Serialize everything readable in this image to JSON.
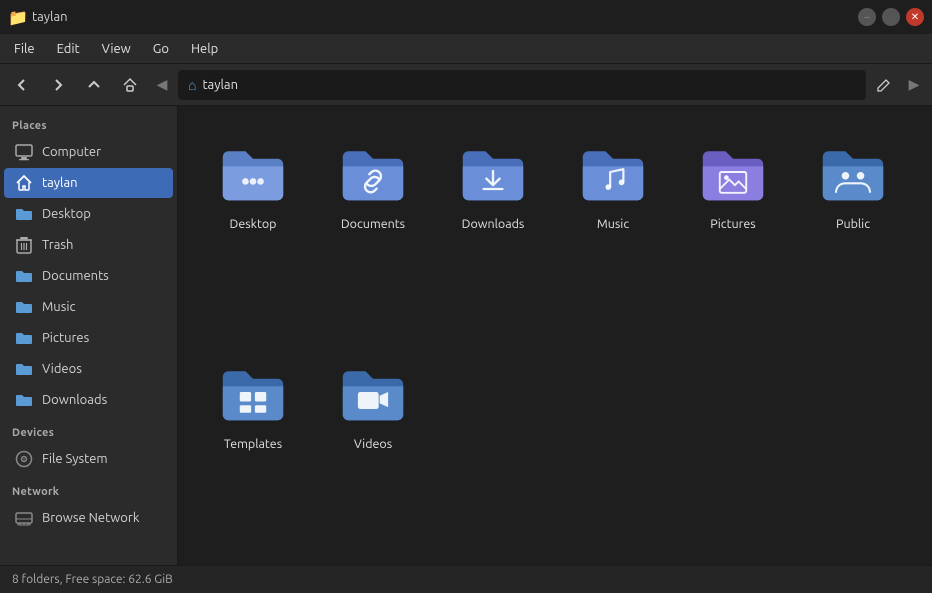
{
  "titlebar": {
    "title": "taylan",
    "icon": "📁"
  },
  "menubar": {
    "items": [
      "File",
      "Edit",
      "View",
      "Go",
      "Help"
    ]
  },
  "toolbar": {
    "back_label": "◀",
    "forward_label": "▶",
    "up_label": "▲",
    "home_label": "⌂",
    "breadcrumb_icon": "⌂",
    "breadcrumb_text": "taylan",
    "edit_label": "✏",
    "nav_left_label": "◀",
    "nav_right_label": "▶"
  },
  "sidebar": {
    "places_label": "Places",
    "devices_label": "Devices",
    "network_label": "Network",
    "items_places": [
      {
        "id": "computer",
        "label": "Computer",
        "icon": "computer"
      },
      {
        "id": "taylan",
        "label": "taylan",
        "icon": "home",
        "active": true
      },
      {
        "id": "desktop",
        "label": "Desktop",
        "icon": "folder"
      },
      {
        "id": "trash",
        "label": "Trash",
        "icon": "trash"
      },
      {
        "id": "documents",
        "label": "Documents",
        "icon": "folder"
      },
      {
        "id": "music",
        "label": "Music",
        "icon": "folder"
      },
      {
        "id": "pictures",
        "label": "Pictures",
        "icon": "folder"
      },
      {
        "id": "videos",
        "label": "Videos",
        "icon": "folder"
      },
      {
        "id": "downloads",
        "label": "Downloads",
        "icon": "folder"
      }
    ],
    "items_devices": [
      {
        "id": "filesystem",
        "label": "File System",
        "icon": "disk"
      }
    ],
    "items_network": [
      {
        "id": "browse-network",
        "label": "Browse Network",
        "icon": "network"
      }
    ]
  },
  "files": [
    {
      "id": "desktop",
      "label": "Desktop",
      "color_main": "#5b7fc5",
      "color_tab": "#7b9de0",
      "icon_type": "dots"
    },
    {
      "id": "documents",
      "label": "Documents",
      "color_main": "#4a6fba",
      "color_tab": "#6a8fd8",
      "icon_type": "link"
    },
    {
      "id": "downloads",
      "label": "Downloads",
      "color_main": "#4a6fba",
      "color_tab": "#6a8fd8",
      "icon_type": "down"
    },
    {
      "id": "music",
      "label": "Music",
      "color_main": "#4a6fba",
      "color_tab": "#6a8fd8",
      "icon_type": "music"
    },
    {
      "id": "pictures",
      "label": "Pictures",
      "color_main": "#6a5fc1",
      "color_tab": "#8a7fe0",
      "icon_type": "image"
    },
    {
      "id": "public",
      "label": "Public",
      "color_main": "#3a6aaa",
      "color_tab": "#5a8aca",
      "icon_type": "people"
    },
    {
      "id": "templates",
      "label": "Templates",
      "color_main": "#3a6aaa",
      "color_tab": "#5a8aca",
      "icon_type": "template"
    },
    {
      "id": "videos",
      "label": "Videos",
      "color_main": "#3a6aaa",
      "color_tab": "#5a8aca",
      "icon_type": "video"
    }
  ],
  "statusbar": {
    "text": "8 folders, Free space: 62.6 GiB"
  }
}
